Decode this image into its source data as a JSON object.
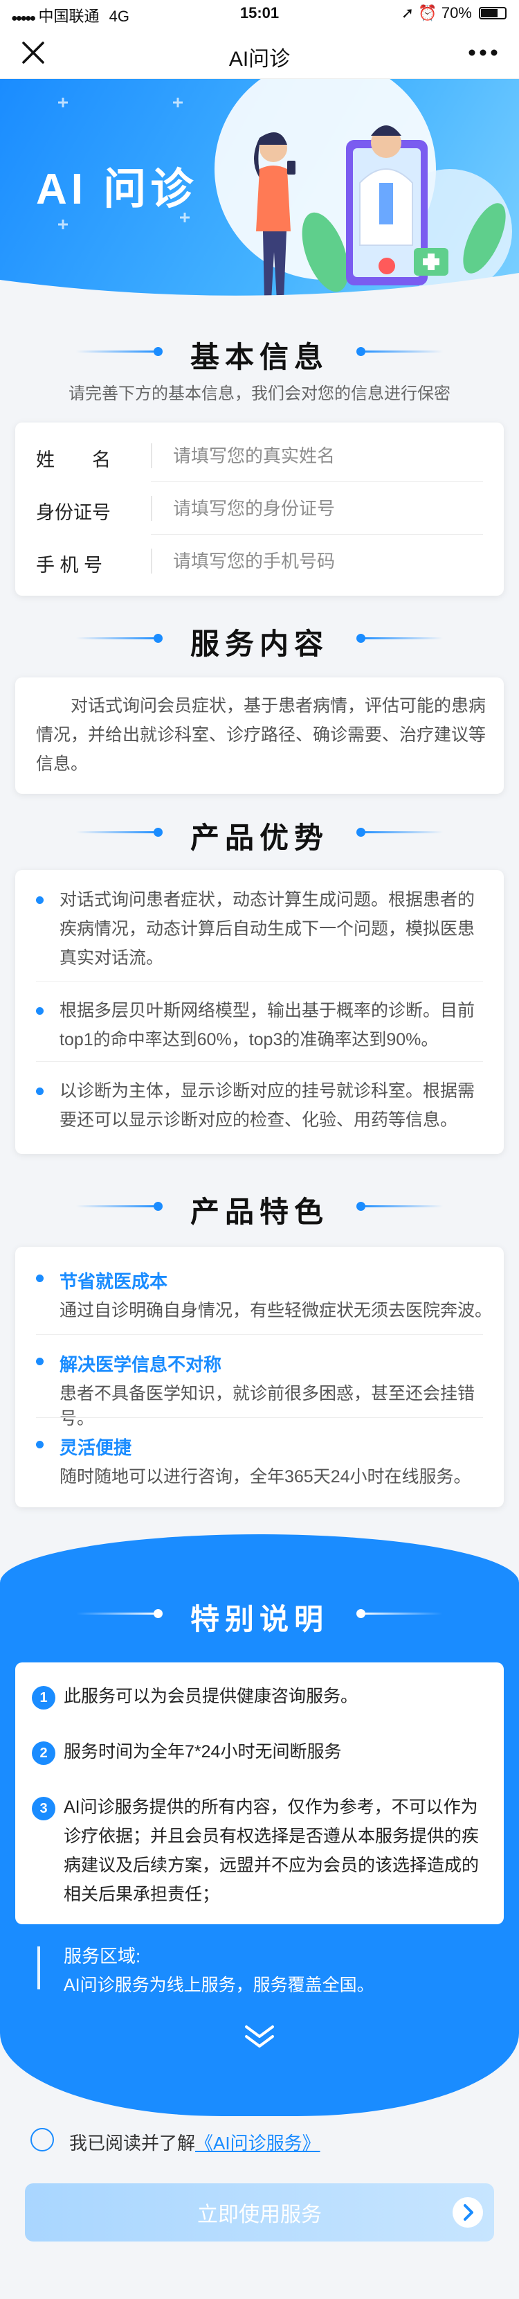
{
  "status_bar": {
    "carrier": "中国联通",
    "network": "4G",
    "time": "15:01",
    "battery": "70%"
  },
  "nav": {
    "title": "AI问诊"
  },
  "hero": {
    "title": "AI 问诊"
  },
  "basic_info": {
    "heading": "基本信息",
    "subtitle": "请完善下方的基本信息，我们会对您的信息进行保密",
    "fields": [
      {
        "label": "姓　　名",
        "placeholder": "请填写您的真实姓名",
        "value": ""
      },
      {
        "label": "身份证号",
        "placeholder": "请填写您的身份证号",
        "value": ""
      },
      {
        "label": "手 机 号",
        "placeholder": "请填写您的手机号码",
        "value": ""
      }
    ]
  },
  "service": {
    "heading": "服务内容",
    "text": "对话式询问会员症状，基于患者病情，评估可能的患病情况，并给出就诊科室、诊疗路径、确诊需要、治疗建议等信息。"
  },
  "advantages": {
    "heading": "产品优势",
    "items": [
      "对话式询问患者症状，动态计算生成问题。根据患者的疾病情况，动态计算后自动生成下一个问题，模拟医患真实对话流。",
      "根据多层贝叶斯网络模型，输出基于概率的诊断。目前top1的命中率达到60%，top3的准确率达到90%。",
      "以诊断为主体，显示诊断对应的挂号就诊科室。根据需要还可以显示诊断对应的检查、化验、用药等信息。"
    ]
  },
  "features": {
    "heading": "产品特色",
    "items": [
      {
        "title": "节省就医成本",
        "desc": "通过自诊明确自身情况，有些轻微症状无须去医院奔波。"
      },
      {
        "title": "解决医学信息不对称",
        "desc": "患者不具备医学知识，就诊前很多困惑，甚至还会挂错号。"
      },
      {
        "title": "灵活便捷",
        "desc": "随时随地可以进行咨询，全年365天24小时在线服务。"
      }
    ]
  },
  "special": {
    "heading": "特别说明",
    "items": [
      "此服务可以为会员提供健康咨询服务。",
      "服务时间为全年7*24小时无间断服务",
      "AI问诊服务提供的所有内容，仅作为参考，不可以作为诊疗依据；并且会员有权选择是否遵从本服务提供的疾病建议及后续方案，远盟并不应为会员的该选择造成的相关后果承担责任；"
    ],
    "area_title": "服务区域:",
    "area_text": "AI问诊服务为线上服务，服务覆盖全国。"
  },
  "agreement": {
    "prefix": "我已阅读并了解",
    "link": "《AI问诊服务》"
  },
  "cta": {
    "label": "立即使用服务"
  }
}
